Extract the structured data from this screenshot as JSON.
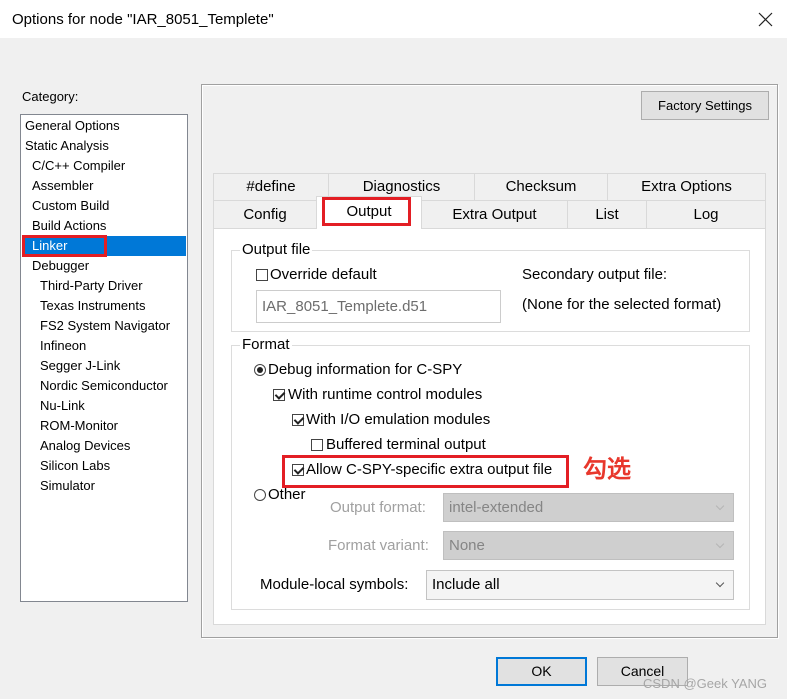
{
  "window": {
    "title": "Options for node \"IAR_8051_Templete\"",
    "close_icon": "close-icon"
  },
  "colors": {
    "selection": "#0078d7",
    "highlight_red": "#e31e24",
    "annotation_red": "#e8372c"
  },
  "category": {
    "label": "Category:",
    "items": [
      {
        "label": "General Options"
      },
      {
        "label": "Static Analysis"
      },
      {
        "label": "C/C++ Compiler"
      },
      {
        "label": "Assembler"
      },
      {
        "label": "Custom Build"
      },
      {
        "label": "Build Actions"
      },
      {
        "label": "Linker",
        "selected": true
      },
      {
        "label": "Debugger"
      },
      {
        "label": "Third-Party Driver"
      },
      {
        "label": "Texas Instruments"
      },
      {
        "label": "FS2 System Navigator"
      },
      {
        "label": "Infineon"
      },
      {
        "label": "Segger J-Link"
      },
      {
        "label": "Nordic Semiconductor"
      },
      {
        "label": "Nu-Link"
      },
      {
        "label": "ROM-Monitor"
      },
      {
        "label": "Analog Devices"
      },
      {
        "label": "Silicon Labs"
      },
      {
        "label": "Simulator"
      }
    ]
  },
  "factory_settings": "Factory Settings",
  "tabs": {
    "back_row": [
      {
        "label": "#define"
      },
      {
        "label": "Diagnostics"
      },
      {
        "label": "Checksum"
      },
      {
        "label": "Extra Options"
      }
    ],
    "front_row": [
      {
        "label": "Config"
      },
      {
        "label": "Output",
        "active": true
      },
      {
        "label": "Extra Output"
      },
      {
        "label": "List"
      },
      {
        "label": "Log"
      }
    ]
  },
  "output_file": {
    "legend": "Output file",
    "override_default": {
      "label": "Override default",
      "checked": false
    },
    "filename": {
      "value": "IAR_8051_Templete.d51",
      "disabled": true
    },
    "secondary_label": "Secondary output file:",
    "secondary_value": "(None for the selected format)"
  },
  "format": {
    "legend": "Format",
    "debug_info": {
      "label": "Debug information for C-SPY",
      "selected": true
    },
    "runtime_control": {
      "label": "With runtime control modules",
      "checked": true
    },
    "io_emulation": {
      "label": "With I/O emulation modules",
      "checked": true
    },
    "buffered_terminal": {
      "label": "Buffered terminal output",
      "checked": false
    },
    "allow_cspy_extra": {
      "label": "Allow C-SPY-specific extra output file",
      "checked": true
    },
    "other": {
      "label": "Other",
      "selected": false
    },
    "output_format": {
      "label": "Output format:",
      "value": "intel-extended",
      "disabled": true
    },
    "format_variant": {
      "label": "Format variant:",
      "value": "None",
      "disabled": true
    },
    "module_local_symbols": {
      "label": "Module-local symbols:",
      "value": "Include all"
    }
  },
  "annotation": {
    "text": "勾选"
  },
  "buttons": {
    "ok": "OK",
    "cancel": "Cancel"
  },
  "watermark": "CSDN @Geek YANG"
}
